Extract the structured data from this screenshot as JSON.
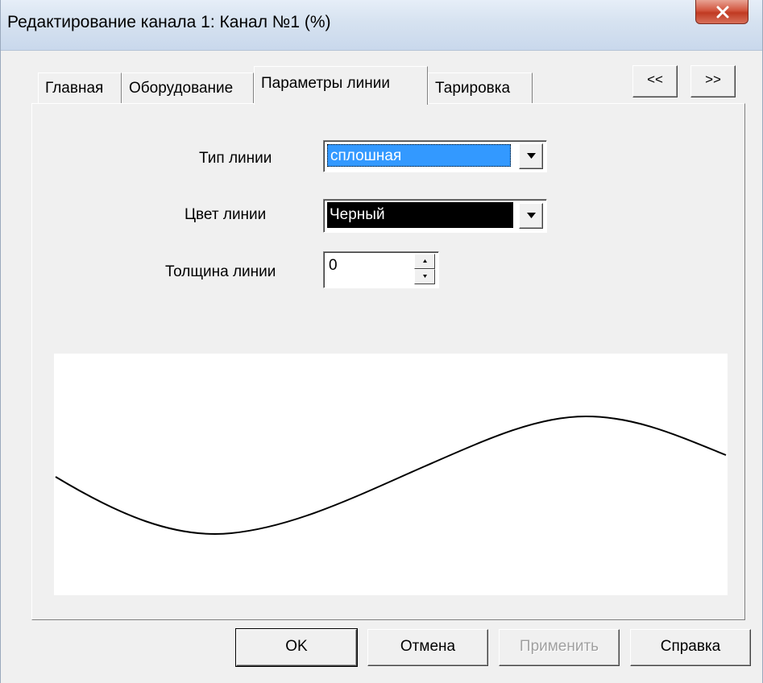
{
  "window": {
    "title": "Редактирование канала 1:  Канал №1 (%)",
    "close_icon": "close-icon"
  },
  "tabs": [
    {
      "label": "Главная",
      "active": false
    },
    {
      "label": "Оборудование",
      "active": false
    },
    {
      "label": "Параметры линии",
      "active": true
    },
    {
      "label": "Тарировка",
      "active": false
    }
  ],
  "nav": {
    "prev_label": "<<",
    "next_label": ">>"
  },
  "fields": {
    "line_type": {
      "label": "Тип линии",
      "value": "сплошная",
      "highlight_color": "#3399ff"
    },
    "line_color": {
      "label": "Цвет линии",
      "value": "Черный",
      "swatch_color": "#000000"
    },
    "line_width": {
      "label": "Толщина линии",
      "value": "0"
    }
  },
  "buttons": {
    "ok": "OK",
    "cancel": "Отмена",
    "apply": "Применить",
    "help": "Справка"
  },
  "colors": {
    "background": "#f0f0f0",
    "selection": "#3399ff",
    "close_button": "#c8452e"
  }
}
